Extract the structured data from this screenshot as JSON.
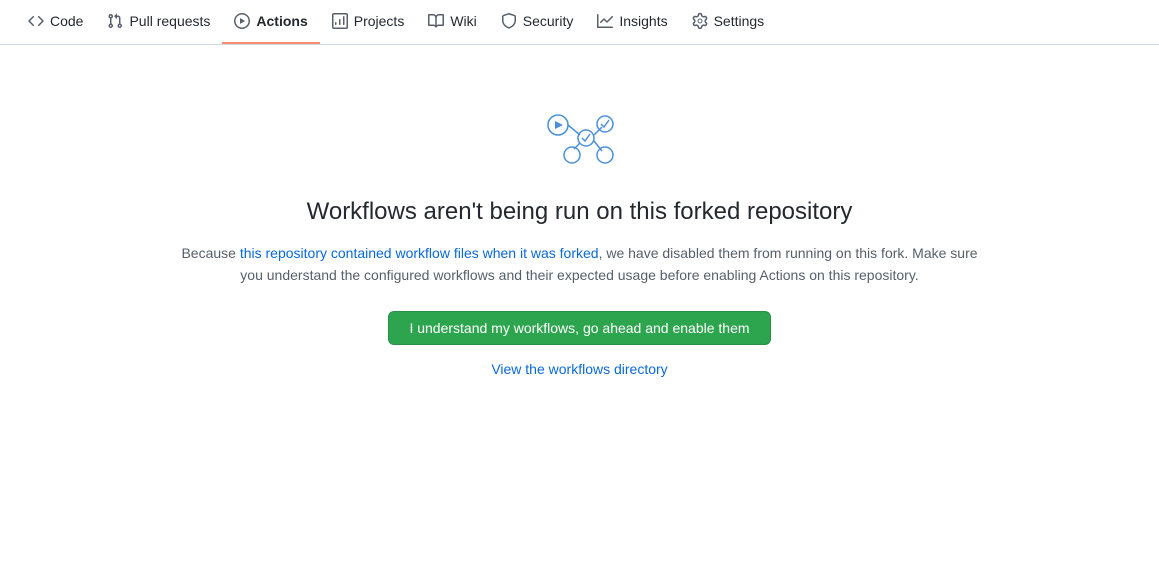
{
  "nav": {
    "items": [
      {
        "id": "code",
        "label": "Code",
        "icon": "code-icon",
        "active": false
      },
      {
        "id": "pull-requests",
        "label": "Pull requests",
        "icon": "pr-icon",
        "active": false
      },
      {
        "id": "actions",
        "label": "Actions",
        "icon": "actions-icon",
        "active": true
      },
      {
        "id": "projects",
        "label": "Projects",
        "icon": "projects-icon",
        "active": false
      },
      {
        "id": "wiki",
        "label": "Wiki",
        "icon": "wiki-icon",
        "active": false
      },
      {
        "id": "security",
        "label": "Security",
        "icon": "security-icon",
        "active": false
      },
      {
        "id": "insights",
        "label": "Insights",
        "icon": "insights-icon",
        "active": false
      },
      {
        "id": "settings",
        "label": "Settings",
        "icon": "settings-icon",
        "active": false
      }
    ]
  },
  "main": {
    "heading": "Workflows aren't being run on this forked repository",
    "description_part1": "Because ",
    "description_link": "this repository contained workflow files when it was forked",
    "description_part2": ", we have disabled them from running on this fork. Make sure you understand the configured workflows and their expected usage before enabling Actions on this repository.",
    "enable_button": "I understand my workflows, go ahead and enable them",
    "workflow_link": "View the workflows directory"
  }
}
